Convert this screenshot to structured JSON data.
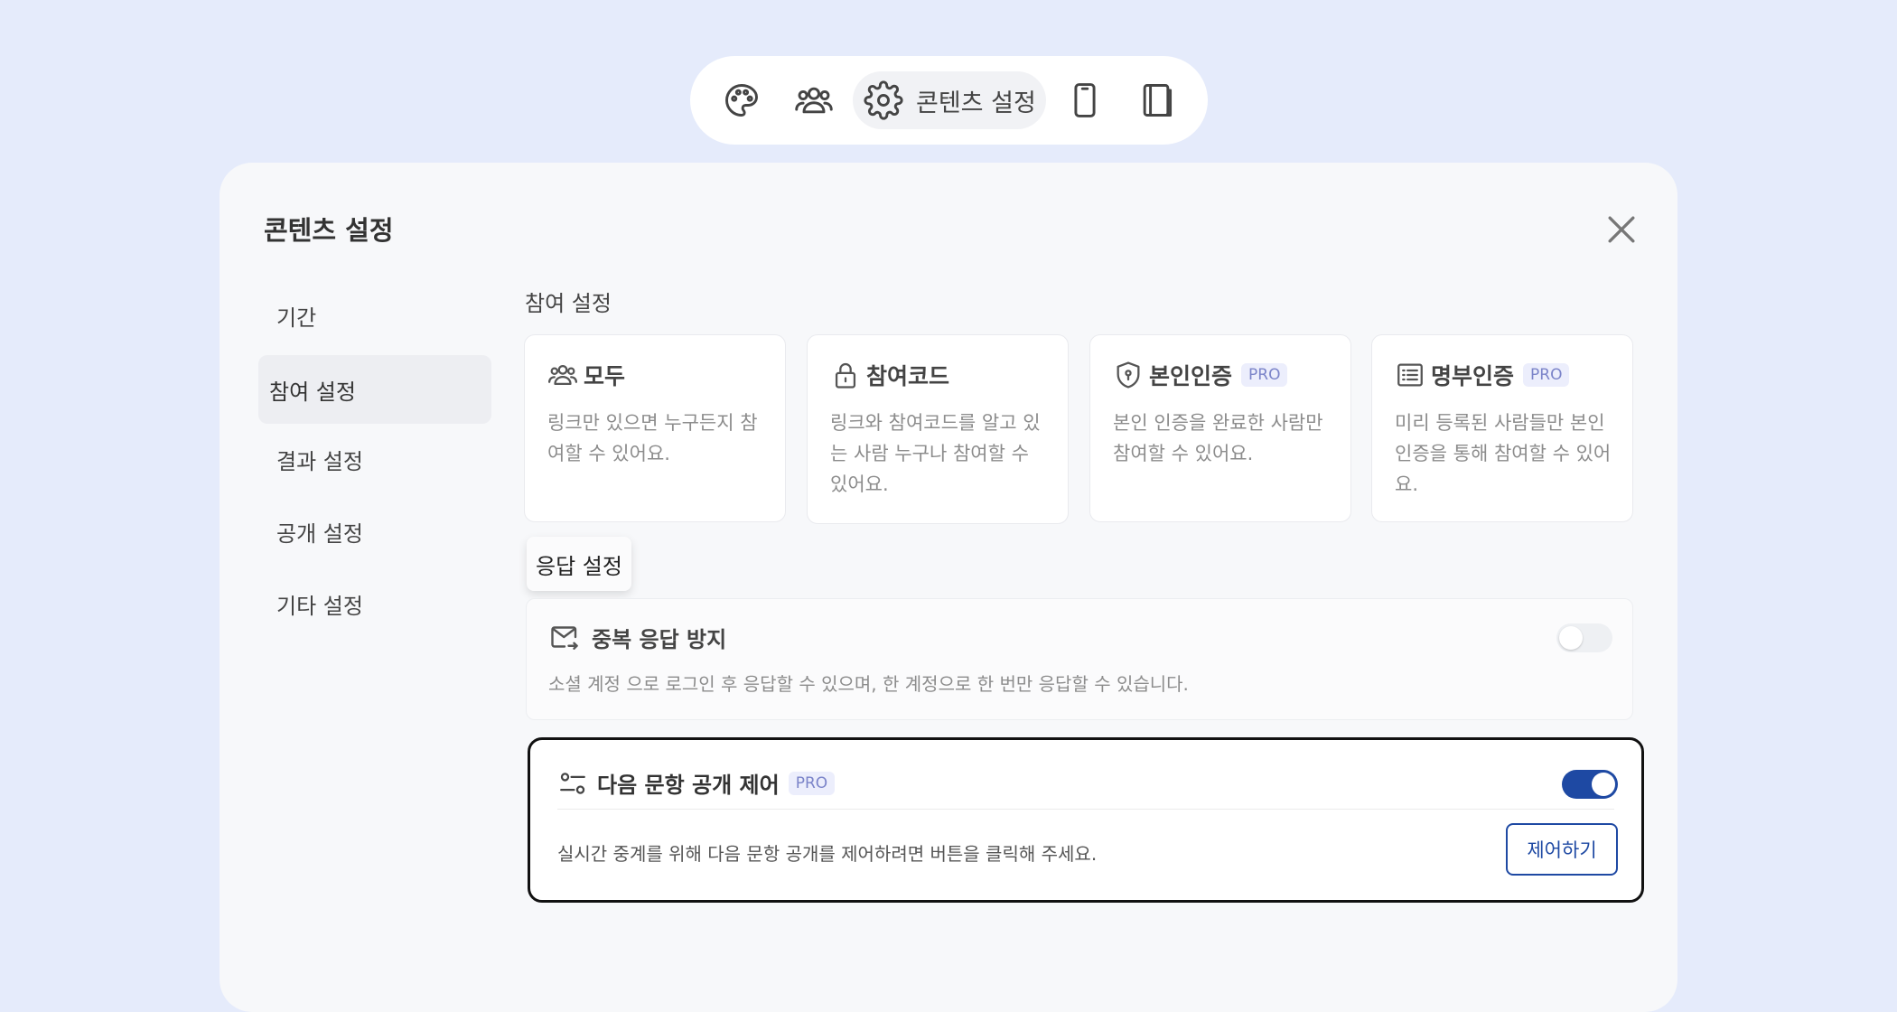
{
  "toolbar": {
    "icons": [
      "palette-icon",
      "users-icon",
      "gear-icon",
      "mobile-icon",
      "book-icon"
    ],
    "active_label": "콘텐츠 설정"
  },
  "modal": {
    "title": "콘텐츠 설정",
    "nav": [
      {
        "label": "기간",
        "active": false
      },
      {
        "label": "참여 설정",
        "active": true
      },
      {
        "label": "결과 설정",
        "active": false
      },
      {
        "label": "공개 설정",
        "active": false
      },
      {
        "label": "기타 설정",
        "active": false
      }
    ]
  },
  "participation": {
    "label": "참여 설정",
    "cards": [
      {
        "icon": "users-icon",
        "title": "모두",
        "pro": false,
        "desc": "링크만 있으면 누구든지 참여할 수 있어요."
      },
      {
        "icon": "lock-icon",
        "title": "참여코드",
        "pro": false,
        "desc": "링크와 참여코드를 알고 있는 사람 누구나 참여할 수 있어요."
      },
      {
        "icon": "shield-icon",
        "title": "본인인증",
        "pro": true,
        "desc": "본인 인증을 완료한 사람만 참여할 수 있어요."
      },
      {
        "icon": "list-icon",
        "title": "명부인증",
        "pro": true,
        "desc": "미리 등록된 사람들만 본인 인증을 통해 참여할 수 있어요."
      }
    ],
    "pro_badge": "PRO"
  },
  "response": {
    "label": "응답 설정",
    "duplicate": {
      "title": "중복 응답 방지",
      "desc": "소셜 계정 으로 로그인 후 응답할 수 있으며, 한 계정으로 한 번만 응답할 수 있습니다.",
      "enabled": false
    },
    "next_question": {
      "title": "다음 문항 공개 제어",
      "pro_badge": "PRO",
      "desc": "실시간 중계를 위해 다음 문항 공개를 제어하려면 버튼을 클릭해 주세요.",
      "enabled": true,
      "button_label": "제어하기"
    }
  },
  "colors": {
    "background": "#e5ebfb",
    "accent": "#1e49a3",
    "pro_badge_text": "#7b84c9",
    "pro_badge_bg": "#eceefc"
  }
}
